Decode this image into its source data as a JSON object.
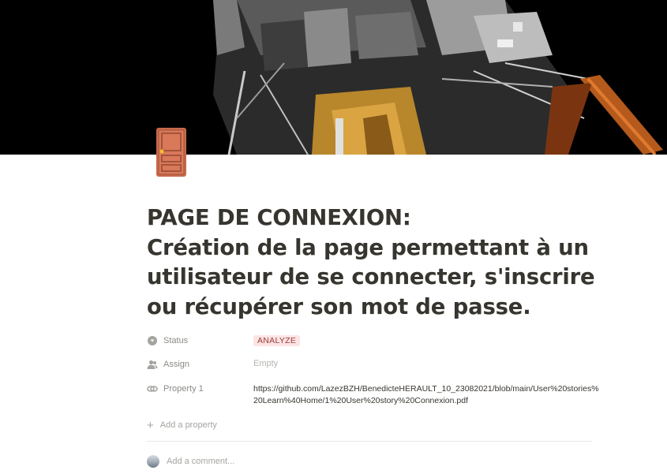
{
  "page": {
    "cover_description": "lunar-module-photo",
    "icon": "door-icon",
    "title_lines": [
      "PAGE DE CONNEXION:",
      "Création de la page permettant à un",
      "utilisateur de se connecter, s'inscrire",
      "ou récupérer son mot de passe."
    ]
  },
  "properties": [
    {
      "name": "Status",
      "icon": "status-icon",
      "type": "select",
      "value": "ANALYZE"
    },
    {
      "name": "Assign",
      "icon": "person-icon",
      "type": "person",
      "value": "Empty"
    },
    {
      "name": "Property 1",
      "icon": "link-icon",
      "type": "url",
      "value": "https://github.com/LazezBZH/BenedicteHERAULT_10_23082021/blob/main/User%20stories%20Learn%40Home/1%20User%20story%20Connexion.pdf"
    }
  ],
  "add_property_label": "Add a property",
  "comment": {
    "placeholder": "Add a comment..."
  },
  "colors": {
    "status_badge_bg": "#fbe4e4",
    "status_badge_text": "#a03a3a",
    "text": "#37352f",
    "muted": "#8b8a86"
  }
}
